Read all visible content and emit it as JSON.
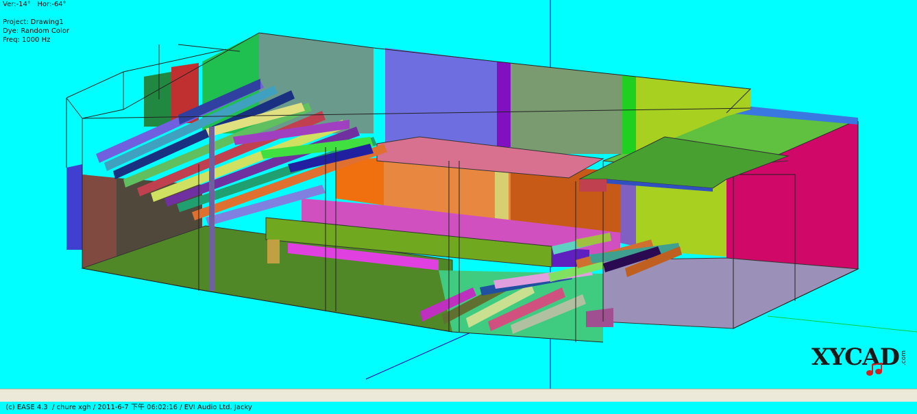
{
  "view": {
    "orientation": "Ver:-14°   Hor:-64°",
    "project": "Project: Drawing1",
    "dye": "Dye: Random Color",
    "freq": "Freq: 1000 Hz"
  },
  "logo": {
    "text": "XYCAD",
    "suffix": ".com"
  },
  "statusbar": {
    "text": "(c) EASE 4.3  / chure xgh / 2011-6-7 下午 06:02:16 / EVI Audio Ltd. Jacky"
  },
  "colors": {
    "background": "#00FFFF",
    "statusbar": "#ECE9D8"
  }
}
